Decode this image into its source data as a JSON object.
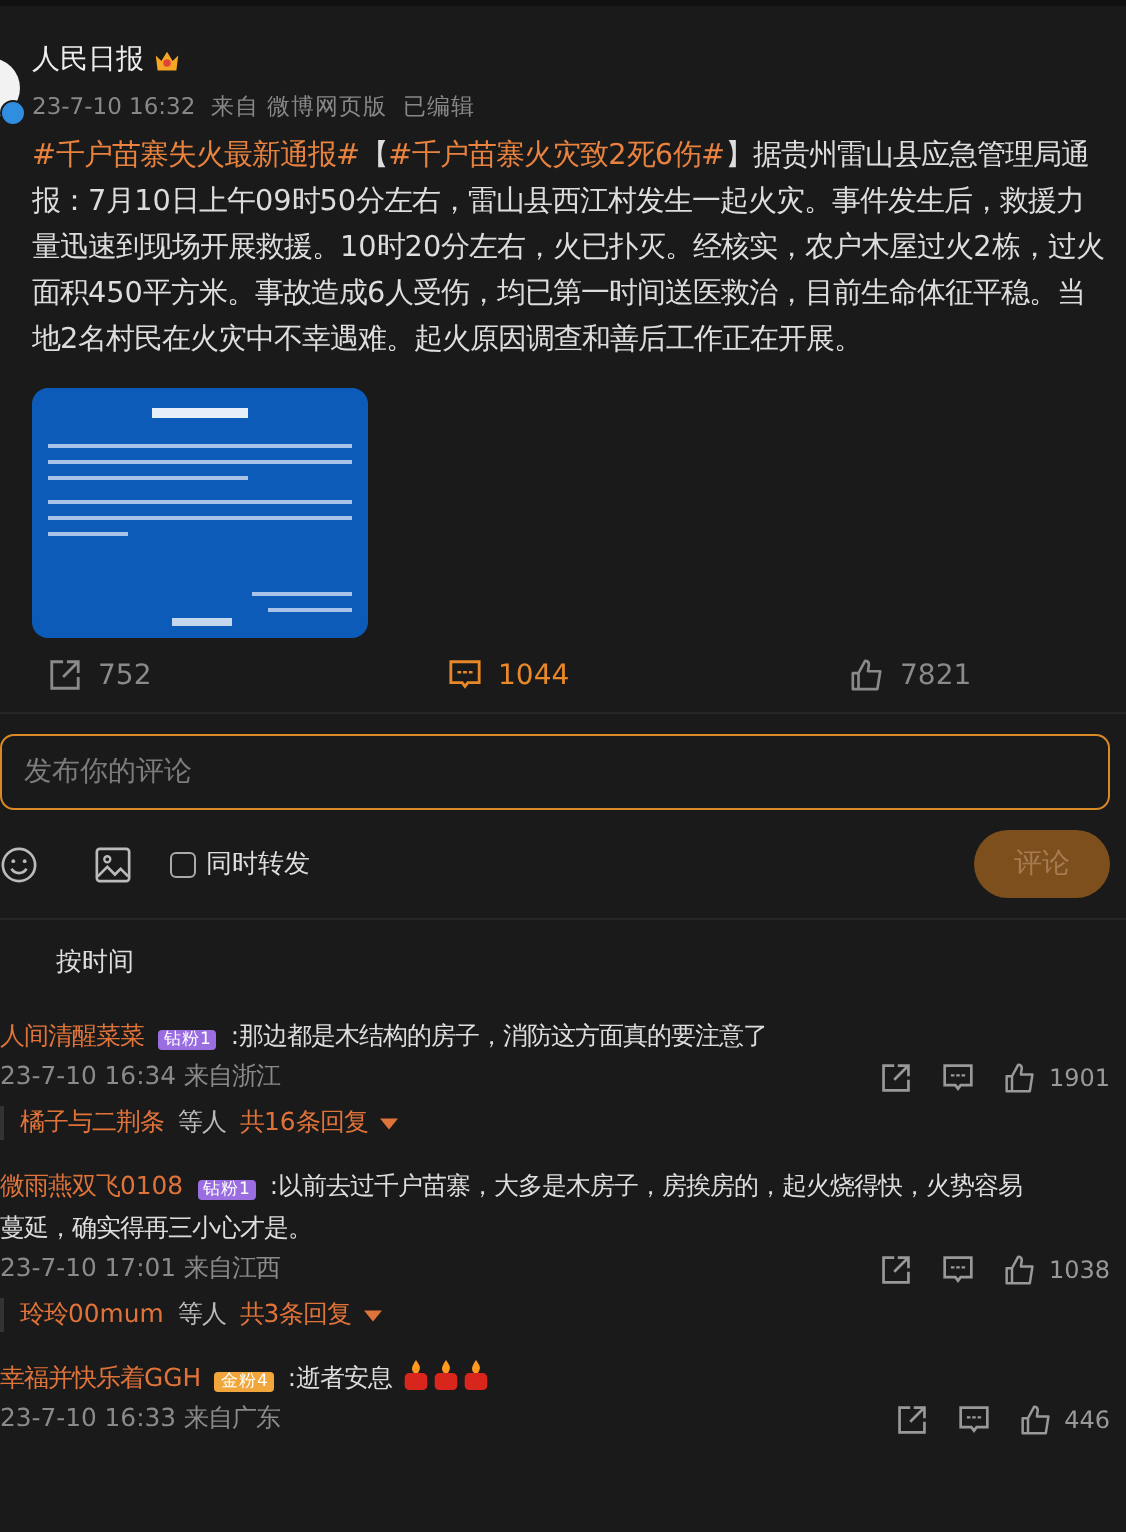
{
  "post": {
    "author": "人民日报",
    "time": "23-7-10 16:32",
    "source": "来自 微博网页版",
    "edited": "已编辑",
    "body": [
      {
        "kind": "hashtag",
        "text": "#千户苗寨失火最新通报#"
      },
      {
        "kind": "plain",
        "text": "【"
      },
      {
        "kind": "hashtag",
        "text": "#千户苗寨火灾致2死6伤#"
      },
      {
        "kind": "plain",
        "text": "】据贵州雷山县应急管理局通报：7月10日上午09时50分左右，雷山县西江村发生一起火灾。事件发生后，救援力量迅速到现场开展救援。10时20分左右，火已扑灭。经核实，农户木屋过火2栋，过火面积450平方米。事故造成6人受伤，均已第一时间送医救治，目前生命体征平稳。当地2名村民在火灾中不幸遇难。起火原因调查和善后工作正在开展。"
      }
    ],
    "stats": [
      {
        "kind": "repost",
        "count": "752",
        "selected": false
      },
      {
        "kind": "comment",
        "count": "1044",
        "selected": true
      },
      {
        "kind": "like",
        "count": "7821",
        "selected": false
      }
    ]
  },
  "comment_box": {
    "placeholder": "发布你的评论",
    "also_repost": {
      "label": "同时转发",
      "checked": false
    },
    "submit": "评论"
  },
  "sort": "按时间",
  "comments": [
    {
      "name": "人间清醒菜菜",
      "badge": {
        "kind": "diamond",
        "label": "钻粉1"
      },
      "text_lines": [
        ":那边都是木结构的房子，消防这方面真的要注意了"
      ],
      "meta": "23-7-10 16:34 来自浙江",
      "likes": "1901",
      "replies": {
        "names": "橘子与二荆条",
        "others": "等人",
        "count": "共16条回复"
      }
    },
    {
      "name": "微雨燕双飞0108",
      "badge": {
        "kind": "diamond",
        "label": "钻粉1"
      },
      "text_lines": [
        ":以前去过千户苗寨，大多是木房子，房挨房的，起火烧得快，火势容易",
        "蔓延，确实得再三小心才是。"
      ],
      "meta": "23-7-10 17:01 来自江西",
      "likes": "1038",
      "replies": {
        "names": "玲玲00mum",
        "others": "等人",
        "count": "共3条回复"
      }
    },
    {
      "name": "幸福并快乐着GGH",
      "badge": {
        "kind": "gold",
        "label": "金粉4"
      },
      "text_lines": [
        ":逝者安息"
      ],
      "emojis": [
        {
          "kind": "candle"
        },
        {
          "kind": "candle"
        },
        {
          "kind": "candle"
        }
      ],
      "meta": "23-7-10 16:33 来自广东",
      "likes": "446"
    }
  ]
}
